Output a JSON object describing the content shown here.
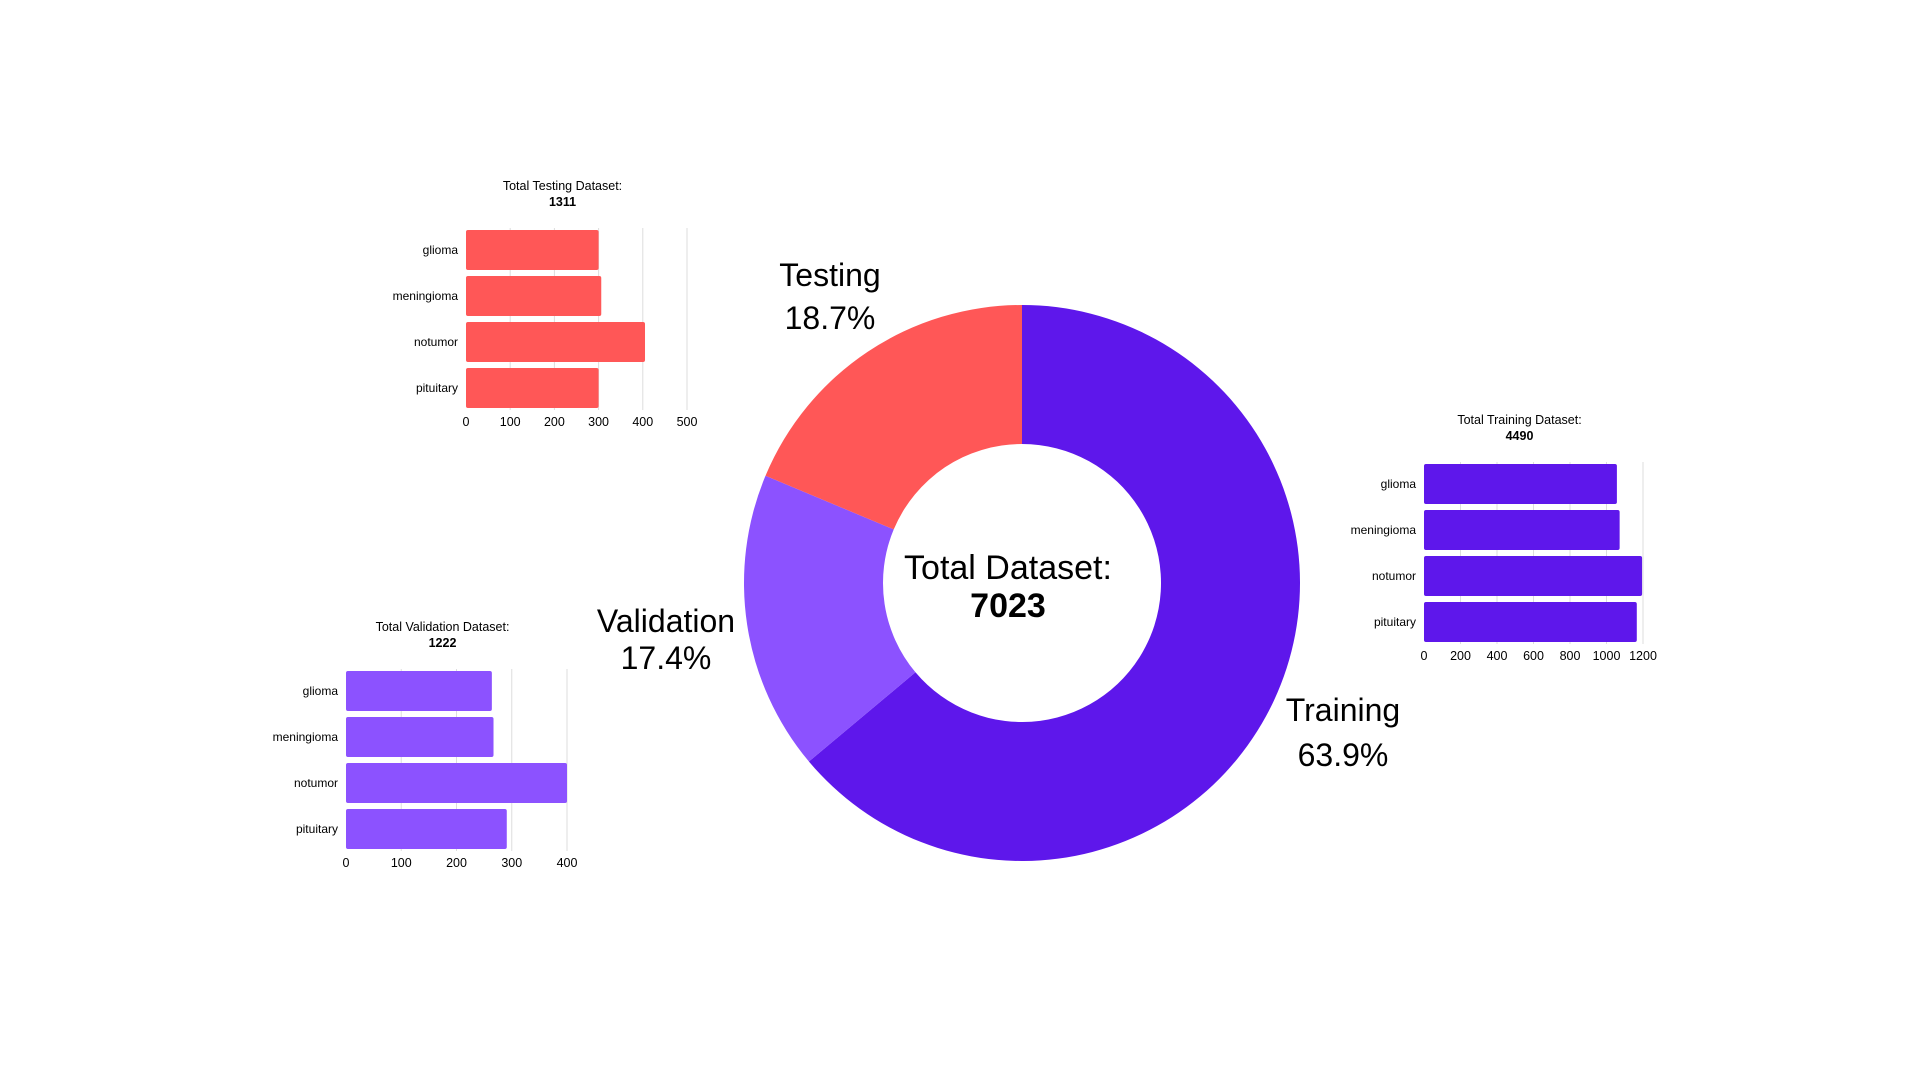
{
  "colors": {
    "testing": "#ff5757",
    "validation": "#8c52ff",
    "training": "#5e17eb",
    "grid": "#dddddd",
    "text": "#111111"
  },
  "chart_data": [
    {
      "type": "pie",
      "variant": "donut",
      "center_title": "Total Dataset:",
      "center_value": "7023",
      "slices": [
        {
          "name": "Training",
          "value": 63.9,
          "label": "63.9%"
        },
        {
          "name": "Validation",
          "value": 17.4,
          "label": "17.4%"
        },
        {
          "name": "Testing",
          "value": 18.7,
          "label": "18.7%"
        }
      ]
    },
    {
      "type": "bar",
      "orientation": "horizontal",
      "title": "Total Testing Dataset:",
      "total": "1311",
      "categories": [
        "glioma",
        "meningioma",
        "notumor",
        "pituitary"
      ],
      "values": [
        300,
        306,
        405,
        300
      ],
      "xlim": [
        0,
        500
      ],
      "ticks": [
        0,
        100,
        200,
        300,
        400,
        500
      ],
      "grid": true
    },
    {
      "type": "bar",
      "orientation": "horizontal",
      "title": "Total Validation Dataset:",
      "total": "1222",
      "categories": [
        "glioma",
        "meningioma",
        "notumor",
        "pituitary"
      ],
      "values": [
        264,
        267,
        400,
        291
      ],
      "xlim": [
        0,
        400
      ],
      "ticks": [
        0,
        100,
        200,
        300,
        400
      ],
      "grid": true
    },
    {
      "type": "bar",
      "orientation": "horizontal",
      "title": "Total Training Dataset:",
      "total": "4490",
      "categories": [
        "glioma",
        "meningioma",
        "notumor",
        "pituitary"
      ],
      "values": [
        1057,
        1072,
        1195,
        1166
      ],
      "xlim": [
        0,
        1200
      ],
      "ticks": [
        0,
        200,
        400,
        600,
        800,
        1000,
        1200
      ],
      "grid": true
    }
  ]
}
